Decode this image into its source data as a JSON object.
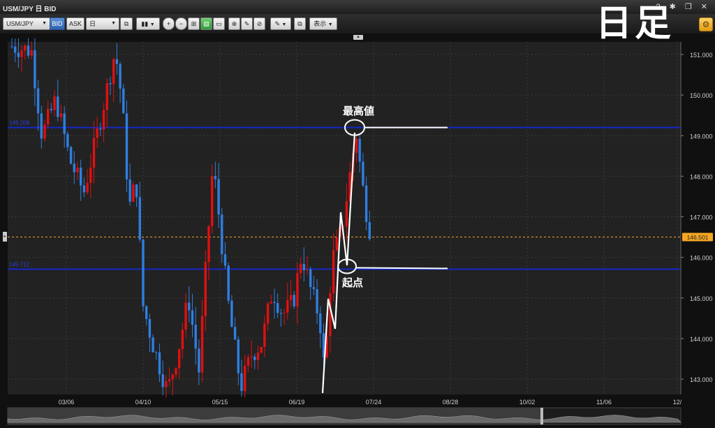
{
  "window": {
    "title": "USM/JPY 日 BID",
    "help_icon": "?",
    "buttons": [
      "settings-icon",
      "restore-icon",
      "close-icon"
    ]
  },
  "overlay_title": "日足",
  "toolbar": {
    "symbol": "USM/JPY",
    "bid_label": "BID",
    "ask_label": "ASK",
    "period": "日",
    "display_label": "表示"
  },
  "chart_data": {
    "type": "candlestick",
    "title": "",
    "x_ticks": [
      "03/06",
      "04/10",
      "05/15",
      "06/19",
      "07/24",
      "08/28",
      "10/02",
      "11/06",
      "12/"
    ],
    "y_ticks": [
      143.0,
      144.0,
      145.0,
      146.0,
      147.0,
      148.0,
      149.0,
      150.0,
      151.0
    ],
    "ylim": [
      142.6,
      151.3
    ],
    "current_price": {
      "value": 146.501,
      "label": "146.501",
      "color": "#f5a623"
    },
    "horizontal_lines": [
      {
        "name": "high_line",
        "value": 149.2,
        "label": "149.208",
        "color": "#1428c8"
      },
      {
        "name": "low_line",
        "value": 145.71,
        "label": "145.712",
        "color": "#1428c8"
      }
    ],
    "annotations": [
      {
        "text": "最高値",
        "value": 149.2
      },
      {
        "text": "起点",
        "value": 145.71
      }
    ],
    "colors": {
      "up": "#e01010",
      "down": "#2f7fe0",
      "background": "#222222",
      "grid": "#3a3a3a"
    }
  }
}
